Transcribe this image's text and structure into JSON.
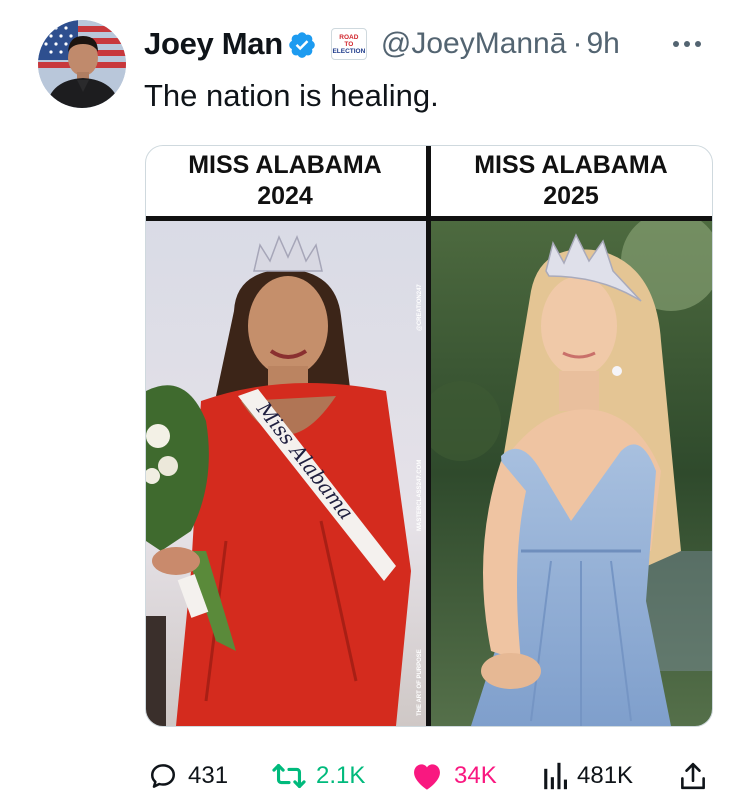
{
  "tweet": {
    "author_name": "Joey Man",
    "badge_line1": "ROAD",
    "badge_line2": "TO",
    "badge_line3": "ELECTION",
    "handle": "@JoeyMannā",
    "separator": "·",
    "time": "9h",
    "text": "The nation is healing."
  },
  "image": {
    "left_label_line1": "MISS ALABAMA",
    "left_label_line2": "2024",
    "right_label_line1": "MISS ALABAMA",
    "right_label_line2": "2025",
    "sash_text": "Miss Alabama",
    "watermark_top": "@CREATION247",
    "watermark_middle": "MASTERCLASS247.COM",
    "watermark_bottom": "THE ART OF PURPOSE"
  },
  "actions": {
    "replies": "431",
    "reposts": "2.1K",
    "likes": "34K",
    "views": "481K"
  },
  "colors": {
    "verified": "#1d9bf0",
    "repost": "#00ba7c",
    "like": "#f91880",
    "secondary_text": "#536471"
  }
}
